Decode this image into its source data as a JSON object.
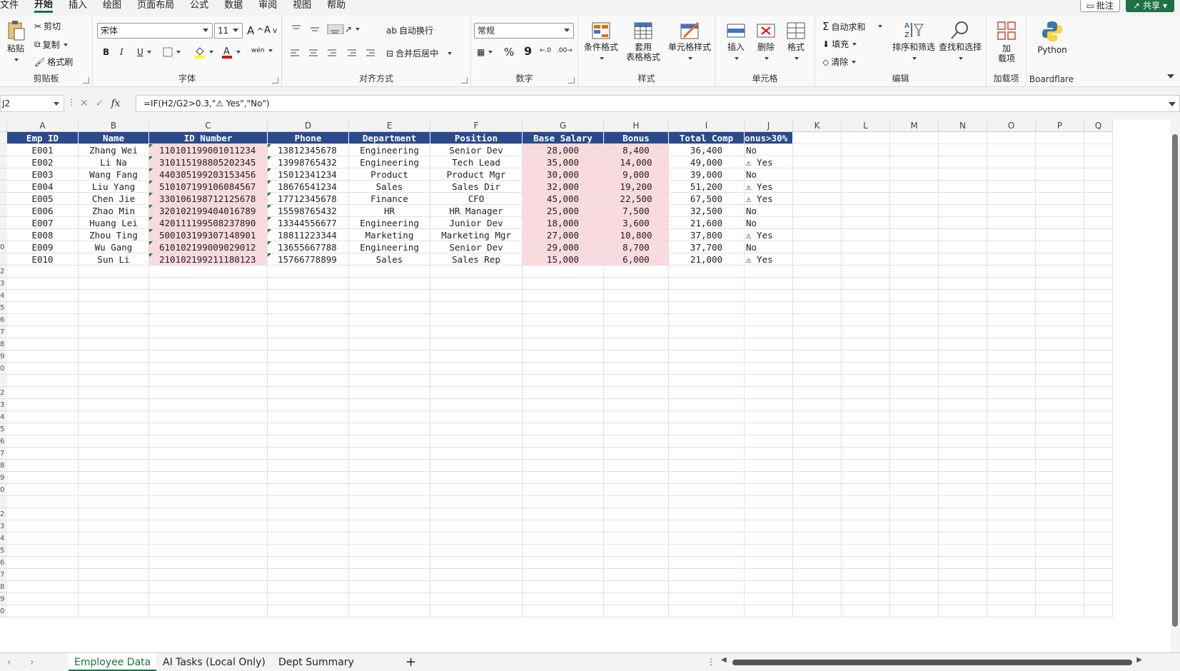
{
  "menu": [
    "文件",
    "开始",
    "插入",
    "绘图",
    "页面布局",
    "公式",
    "数据",
    "审阅",
    "视图",
    "帮助"
  ],
  "menu_active": "开始",
  "top_right": {
    "comment": "批注",
    "share": "共享"
  },
  "ribbon": {
    "clipboard": {
      "paste": "粘贴",
      "cut": "剪切",
      "copy": "复制",
      "format_painter": "格式刷",
      "label": "剪贴板"
    },
    "font": {
      "name": "宋体",
      "size": "11",
      "label": "字体",
      "bold": "B",
      "italic": "I",
      "underline": "U",
      "increase": "A",
      "decrease": "A",
      "phonetic": "wén"
    },
    "align": {
      "wrap": "自动换行",
      "merge": "合并后居中",
      "label": "对齐方式"
    },
    "number": {
      "format": "常规",
      "label": "数字",
      "percent": "%",
      "comma": "9"
    },
    "styles": {
      "conditional": "条件格式",
      "table1": "套用",
      "table2": "表格格式",
      "cell_styles": "单元格样式",
      "label": "样式"
    },
    "cells": {
      "insert": "插入",
      "delete": "删除",
      "format": "格式",
      "label": "单元格"
    },
    "editing": {
      "autosum": "自动求和",
      "fill": "填充",
      "clear": "清除",
      "sort": "排序和筛选",
      "find": "查找和选择",
      "label": "编辑"
    },
    "addins": {
      "add1": "加",
      "add2": "载项",
      "label": "加载项"
    },
    "python": {
      "name": "Python",
      "label": "Boardflare"
    }
  },
  "formula_bar": {
    "name_box": "J2",
    "fx": "fx",
    "formula": "=IF(H2/G2>0.3,\"⚠ Yes\",\"No\")"
  },
  "columns": [
    "A",
    "B",
    "C",
    "D",
    "E",
    "F",
    "G",
    "H",
    "I",
    "J",
    "K",
    "L",
    "M",
    "N",
    "O",
    "P",
    "Q"
  ],
  "table": {
    "headers": [
      "Emp ID",
      "Name",
      "ID Number",
      "Phone",
      "Department",
      "Position",
      "Base Salary",
      "Bonus",
      "Total Comp",
      "onus>30%"
    ],
    "rows": [
      [
        "E001",
        "Zhang Wei",
        "110101199001011234",
        "13812345678",
        "Engineering",
        "Senior Dev",
        "28,000",
        "8,400",
        "36,400",
        "No"
      ],
      [
        "E002",
        "Li Na",
        "310115198805202345",
        "13998765432",
        "Engineering",
        "Tech Lead",
        "35,000",
        "14,000",
        "49,000",
        "⚠ Yes"
      ],
      [
        "E003",
        "Wang Fang",
        "440305199203153456",
        "15012341234",
        "Product",
        "Product Mgr",
        "30,000",
        "9,000",
        "39,000",
        "No"
      ],
      [
        "E004",
        "Liu Yang",
        "510107199106084567",
        "18676541234",
        "Sales",
        "Sales Dir",
        "32,000",
        "19,200",
        "51,200",
        "⚠ Yes"
      ],
      [
        "E005",
        "Chen Jie",
        "330106198712125678",
        "17712345678",
        "Finance",
        "CFO",
        "45,000",
        "22,500",
        "67,500",
        "⚠ Yes"
      ],
      [
        "E006",
        "Zhao Min",
        "320102199404016789",
        "15598765432",
        "HR",
        "HR Manager",
        "25,000",
        "7,500",
        "32,500",
        "No"
      ],
      [
        "E007",
        "Huang Lei",
        "420111199508237890",
        "13344556677",
        "Engineering",
        "Junior Dev",
        "18,000",
        "3,600",
        "21,600",
        "No"
      ],
      [
        "E008",
        "Zhou Ting",
        "500103199307148901",
        "18811223344",
        "Marketing",
        "Marketing Mgr",
        "27,000",
        "10,800",
        "37,800",
        "⚠ Yes"
      ],
      [
        "E009",
        "Wu Gang",
        "610102199009029012",
        "13655667788",
        "Engineering",
        "Senior Dev",
        "29,000",
        "8,700",
        "37,700",
        "No"
      ],
      [
        "E010",
        "Sun Li",
        "210102199211180123",
        "15766778899",
        "Sales",
        "Sales Rep",
        "15,000",
        "6,000",
        "21,000",
        "⚠ Yes"
      ]
    ]
  },
  "row_numbers": [
    "",
    "",
    "",
    "",
    "",
    "",
    "",
    "",
    "",
    "0",
    "",
    "2",
    "3",
    "4",
    "5",
    "6",
    "7",
    "8",
    "9",
    "0",
    "",
    "2",
    "3",
    "4",
    "5",
    "6",
    "7",
    "8",
    "9",
    "0",
    "",
    "2",
    "3",
    "4",
    "5",
    "6",
    "7",
    "8",
    "9",
    "0"
  ],
  "sheets": [
    "Employee Data",
    "AI Tasks (Local Only)",
    "Dept Summary"
  ],
  "active_sheet": "Employee Data",
  "add_sheet": "+",
  "colors": {
    "header_bg": "#2b4a8b",
    "pink": "#fadadd",
    "accent": "#1e7145"
  }
}
